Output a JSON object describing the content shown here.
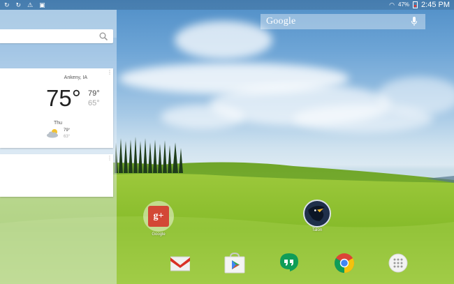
{
  "statusbar": {
    "left_icons": [
      "sync-icon",
      "sync-icon",
      "warning-icon",
      "briefcase-icon"
    ],
    "wifi_icon": "wifi-icon",
    "battery_percent": "47%",
    "time": "2:45 PM"
  },
  "google_search": {
    "label": "Google",
    "mic_icon": "mic-icon"
  },
  "now_search": {
    "search_icon": "search-icon"
  },
  "weather": {
    "location": "Ankeny, IA",
    "current_temp": "75°",
    "high": "79°",
    "low": "65°",
    "forecast": {
      "day": "Thu",
      "high": "79°",
      "low": "63°",
      "icon": "partly-cloudy-icon"
    }
  },
  "apps": [
    {
      "name": "google-plus",
      "label": "Google"
    },
    {
      "name": "bird-app",
      "label": "Talon"
    }
  ],
  "dock": [
    {
      "name": "gmail",
      "icon": "gmail-icon"
    },
    {
      "name": "play-store",
      "icon": "play-store-icon"
    },
    {
      "name": "hangouts",
      "icon": "hangouts-icon"
    },
    {
      "name": "chrome",
      "icon": "chrome-icon"
    },
    {
      "name": "app-drawer",
      "icon": "app-drawer-icon"
    }
  ],
  "colors": {
    "gplus": "#d34836",
    "hangouts": "#0f9d58",
    "gmail_red": "#d93025"
  }
}
